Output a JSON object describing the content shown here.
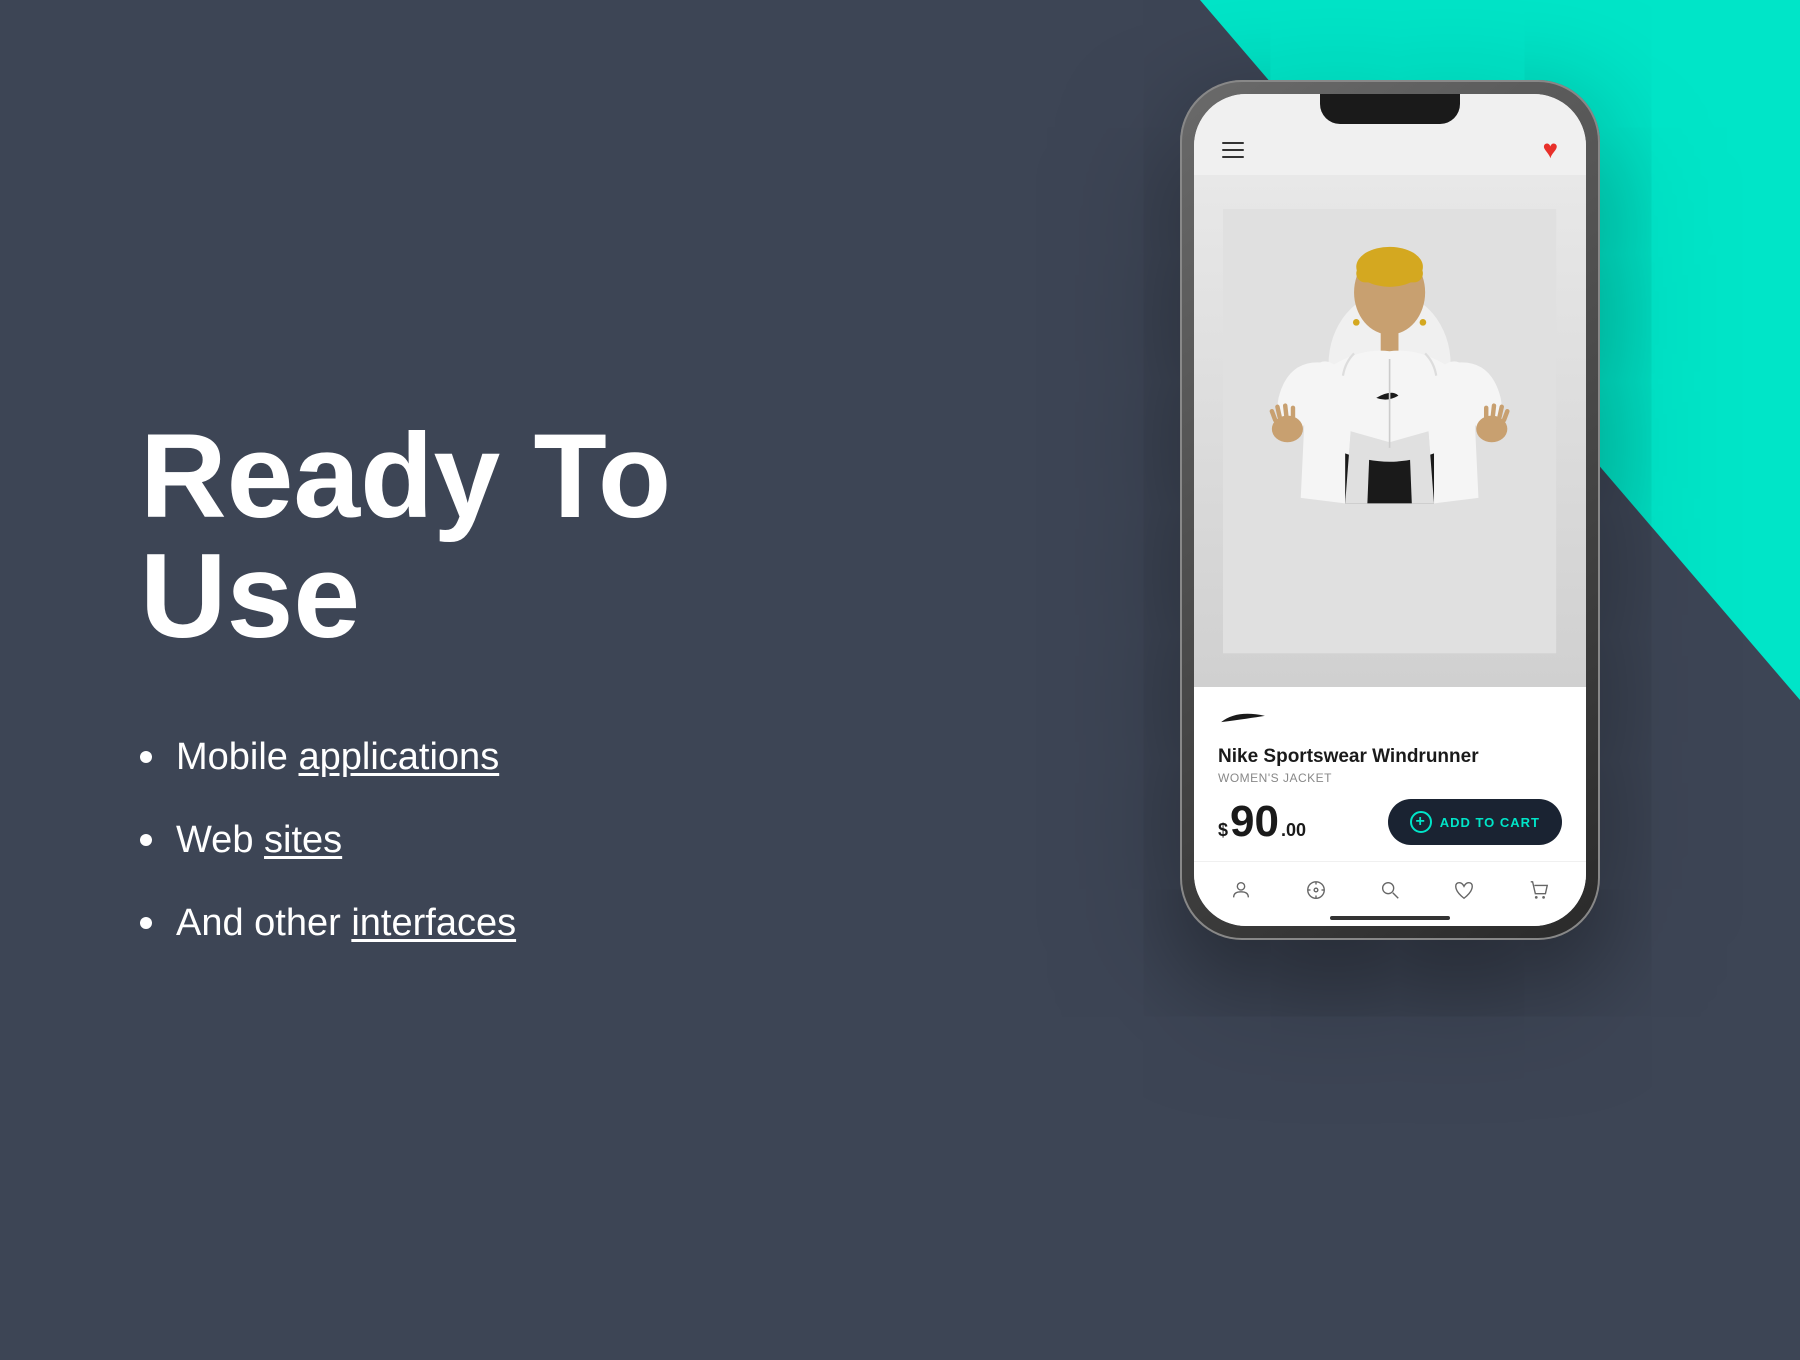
{
  "page": {
    "background_color": "#3d4555",
    "teal_color": "#00e5c8"
  },
  "left": {
    "headline_line1": "Ready To",
    "headline_line2": "Use",
    "bullets": [
      {
        "text_plain": "Mobile ",
        "text_link": "applications"
      },
      {
        "text_plain": "Web ",
        "text_link": "sites"
      },
      {
        "text_plain": "And other ",
        "text_link": "interfaces"
      }
    ]
  },
  "phone": {
    "topbar": {
      "menu_label": "hamburger menu",
      "favorite_label": "favorite heart"
    },
    "product": {
      "brand": "Nike",
      "name": "Nike Sportswear Windrunner",
      "category": "WOMEN'S JACKET",
      "price_symbol": "$",
      "price_main": "90",
      "price_cents": ".00",
      "add_to_cart_label": "ADD TO CART"
    },
    "bottom_nav": [
      "profile",
      "explore",
      "search",
      "wishlist",
      "cart"
    ]
  }
}
